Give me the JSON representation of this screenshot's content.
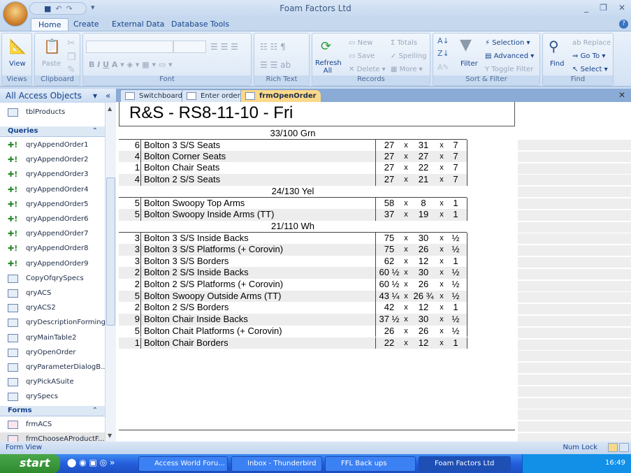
{
  "app": {
    "title": "Foam Factors Ltd",
    "help_icon": "help-icon"
  },
  "ribbon": {
    "tabs": [
      "Home",
      "Create",
      "External Data",
      "Database Tools"
    ],
    "groups": {
      "views": "Views",
      "clipboard": "Clipboard",
      "font": "Font",
      "rich_text": "Rich Text",
      "records": "Records",
      "sort_filter": "Sort & Filter",
      "find": "Find"
    },
    "buttons": {
      "view": "View",
      "paste": "Paste",
      "refresh": "Refresh All",
      "new": "New",
      "save": "Save",
      "delete": "Delete",
      "totals": "Totals",
      "spelling": "Spelling",
      "more": "More",
      "filter": "Filter",
      "selection": "Selection",
      "advanced": "Advanced",
      "toggle_filter": "Toggle Filter",
      "find": "Find",
      "replace": "Replace",
      "goto": "Go To",
      "select": "Select"
    }
  },
  "nav": {
    "title": "All Access Objects",
    "top_item": "tblProducts",
    "sections": [
      {
        "label": "Queries",
        "items": [
          "qryAppendOrder1",
          "qryAppendOrder2",
          "qryAppendOrder3",
          "qryAppendOrder4",
          "qryAppendOrder5",
          "qryAppendOrder6",
          "qryAppendOrder7",
          "qryAppendOrder8",
          "qryAppendOrder9",
          "CopyOfqrySpecs",
          "qryACS",
          "qryACS2",
          "qryDescriptionForming",
          "qryMainTable2",
          "qryOpenOrder",
          "qryParameterDialogB...",
          "qryPickASuite",
          "qrySpecs"
        ]
      },
      {
        "label": "Forms",
        "items": [
          "frmACS",
          "frmChooseAProductF..."
        ]
      }
    ]
  },
  "doc_tabs": [
    {
      "label": "Switchboard"
    },
    {
      "label": "Enter order"
    },
    {
      "label": "frmOpenOrder",
      "active": true
    }
  ],
  "form": {
    "header": "R&S  -  RS8-11-10  -  Fri",
    "groups": [
      {
        "header": "33/100 Grn",
        "items": [
          {
            "qty": "6",
            "desc": "Bolton 3 S/S Seats",
            "dims": [
              "27",
              "31",
              "7"
            ]
          },
          {
            "qty": "4",
            "desc": "Bolton Corner Seats",
            "dims": [
              "27",
              "27",
              "7"
            ]
          },
          {
            "qty": "1",
            "desc": "Bolton Chair Seats",
            "dims": [
              "27",
              "22",
              "7"
            ]
          },
          {
            "qty": "4",
            "desc": "Bolton 2 S/S Seats",
            "dims": [
              "27",
              "21",
              "7"
            ]
          }
        ]
      },
      {
        "header": "24/130 Yel",
        "items": [
          {
            "qty": "5",
            "desc": "Bolton Swoopy Top Arms",
            "dims": [
              "58",
              "8",
              "1"
            ]
          },
          {
            "qty": "5",
            "desc": "Bolton Swoopy Inside Arms (TT)",
            "dims": [
              "37",
              "19",
              "1"
            ]
          }
        ]
      },
      {
        "header": "21/110 Wh",
        "items": [
          {
            "qty": "3",
            "desc": "Bolton 3 S/S Inside Backs",
            "dims": [
              "75",
              "30",
              "½"
            ]
          },
          {
            "qty": "3",
            "desc": "Bolton 3 S/S Platforms (+ Corovin)",
            "dims": [
              "75",
              "26",
              "½"
            ]
          },
          {
            "qty": "3",
            "desc": "Bolton 3 S/S Borders",
            "dims": [
              "62",
              "12",
              "1"
            ]
          },
          {
            "qty": "2",
            "desc": "Bolton 2 S/S Inside Backs",
            "dims": [
              "60 ½",
              "30",
              "½"
            ]
          },
          {
            "qty": "2",
            "desc": "Bolton 2 S/S Platforms (+ Corovin)",
            "dims": [
              "60 ½",
              "26",
              "½"
            ]
          },
          {
            "qty": "5",
            "desc": "Bolton Swoopy Outside Arms (TT)",
            "dims": [
              "43 ¼",
              "26 ¾",
              "½"
            ]
          },
          {
            "qty": "2",
            "desc": "Bolton 2 S/S Borders",
            "dims": [
              "42",
              "12",
              "1"
            ]
          },
          {
            "qty": "9",
            "desc": "Bolton Chair Inside Backs",
            "dims": [
              "37 ½",
              "30",
              "½"
            ]
          },
          {
            "qty": "5",
            "desc": "Bolton Chait Platforms (+ Corovin)",
            "dims": [
              "26",
              "26",
              "½"
            ]
          },
          {
            "qty": "1",
            "desc": "Bolton Chair Borders",
            "dims": [
              "22",
              "12",
              "1"
            ]
          }
        ]
      }
    ],
    "times": "x"
  },
  "status": {
    "left": "Form View",
    "right": "Num Lock"
  },
  "taskbar": {
    "start": "start",
    "buttons": [
      "Access World Foru...",
      "Inbox - Thunderbird",
      "FFL Back ups",
      "Foam Factors Ltd"
    ],
    "clock": "16:49"
  }
}
